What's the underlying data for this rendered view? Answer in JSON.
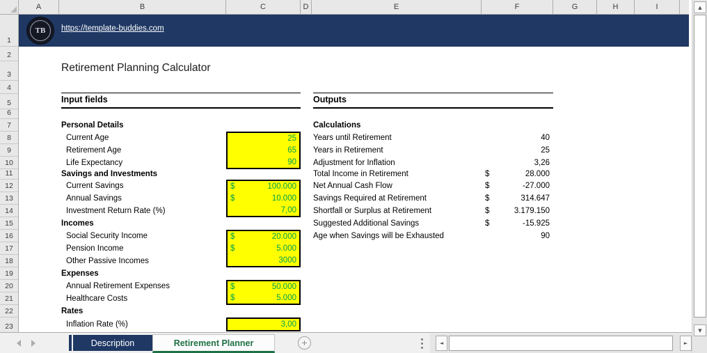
{
  "brand": {
    "url": "https://template-buddies.com",
    "logo_text": "TB"
  },
  "title": "Retirement Planning Calculator",
  "grid": {
    "column_headers": [
      "A",
      "B",
      "C",
      "D",
      "E",
      "F",
      "G",
      "H",
      "I"
    ],
    "row_numbers": [
      "1",
      "2",
      "3",
      "4",
      "5",
      "6",
      "7",
      "8",
      "9",
      "10",
      "11",
      "12",
      "13",
      "14",
      "15",
      "16",
      "17",
      "18",
      "19",
      "20",
      "21",
      "22",
      "23"
    ]
  },
  "inputs": {
    "heading": "Input fields",
    "groups": [
      {
        "label": "Personal Details",
        "items": [
          {
            "label": "Current Age",
            "currency": "",
            "value": "25"
          },
          {
            "label": "Retirement Age",
            "currency": "",
            "value": "65"
          },
          {
            "label": "Life Expectancy",
            "currency": "",
            "value": "90"
          }
        ]
      },
      {
        "label": "Savings and Investments",
        "items": [
          {
            "label": "Current Savings",
            "currency": "$",
            "value": "100.000"
          },
          {
            "label": "Annual Savings",
            "currency": "$",
            "value": "10.000"
          },
          {
            "label": "Investment Return Rate (%)",
            "currency": "",
            "value": "7,00"
          }
        ]
      },
      {
        "label": "Incomes",
        "items": [
          {
            "label": "Social Security Income",
            "currency": "$",
            "value": "20.000"
          },
          {
            "label": "Pension Income",
            "currency": "$",
            "value": "5.000"
          },
          {
            "label": "Other Passive Incomes",
            "currency": "",
            "value": "3000"
          }
        ]
      },
      {
        "label": "Expenses",
        "items": [
          {
            "label": "Annual Retirement Expenses",
            "currency": "$",
            "value": "50.000"
          },
          {
            "label": "Healthcare Costs",
            "currency": "$",
            "value": "5.000"
          }
        ]
      },
      {
        "label": "Rates",
        "items": [
          {
            "label": "Inflation Rate (%)",
            "currency": "",
            "value": "3,00"
          }
        ]
      }
    ]
  },
  "outputs": {
    "heading": "Outputs",
    "group_label": "Calculations",
    "items": [
      {
        "label": "Years until Retirement",
        "currency": "",
        "value": "40"
      },
      {
        "label": "Years in Retirement",
        "currency": "",
        "value": "25"
      },
      {
        "label": "Adjustment for Inflation",
        "currency": "",
        "value": "3,26"
      },
      {
        "label": "Total Income in Retirement",
        "currency": "$",
        "value": "28.000"
      },
      {
        "label": "Net Annual Cash Flow",
        "currency": "$",
        "value": "-27.000"
      },
      {
        "label": "Savings Required at Retirement",
        "currency": "$",
        "value": "314.647"
      },
      {
        "label": "Shortfall or Surplus at Retirement",
        "currency": "$",
        "value": "3.179.150"
      },
      {
        "label": "Suggested Additional Savings",
        "currency": "$",
        "value": "-15.925"
      },
      {
        "label": "Age when Savings will be Exhausted",
        "currency": "",
        "value": "90"
      }
    ]
  },
  "sheet_tabs": {
    "tabs": [
      {
        "label": "Description",
        "active": false
      },
      {
        "label": "Retirement Planner",
        "active": true
      }
    ],
    "add_label": "+"
  },
  "colors": {
    "navy": "#1F3864",
    "input_fill": "#FFFF00",
    "input_text": "#00A050",
    "tab_green": "#1E7145"
  }
}
